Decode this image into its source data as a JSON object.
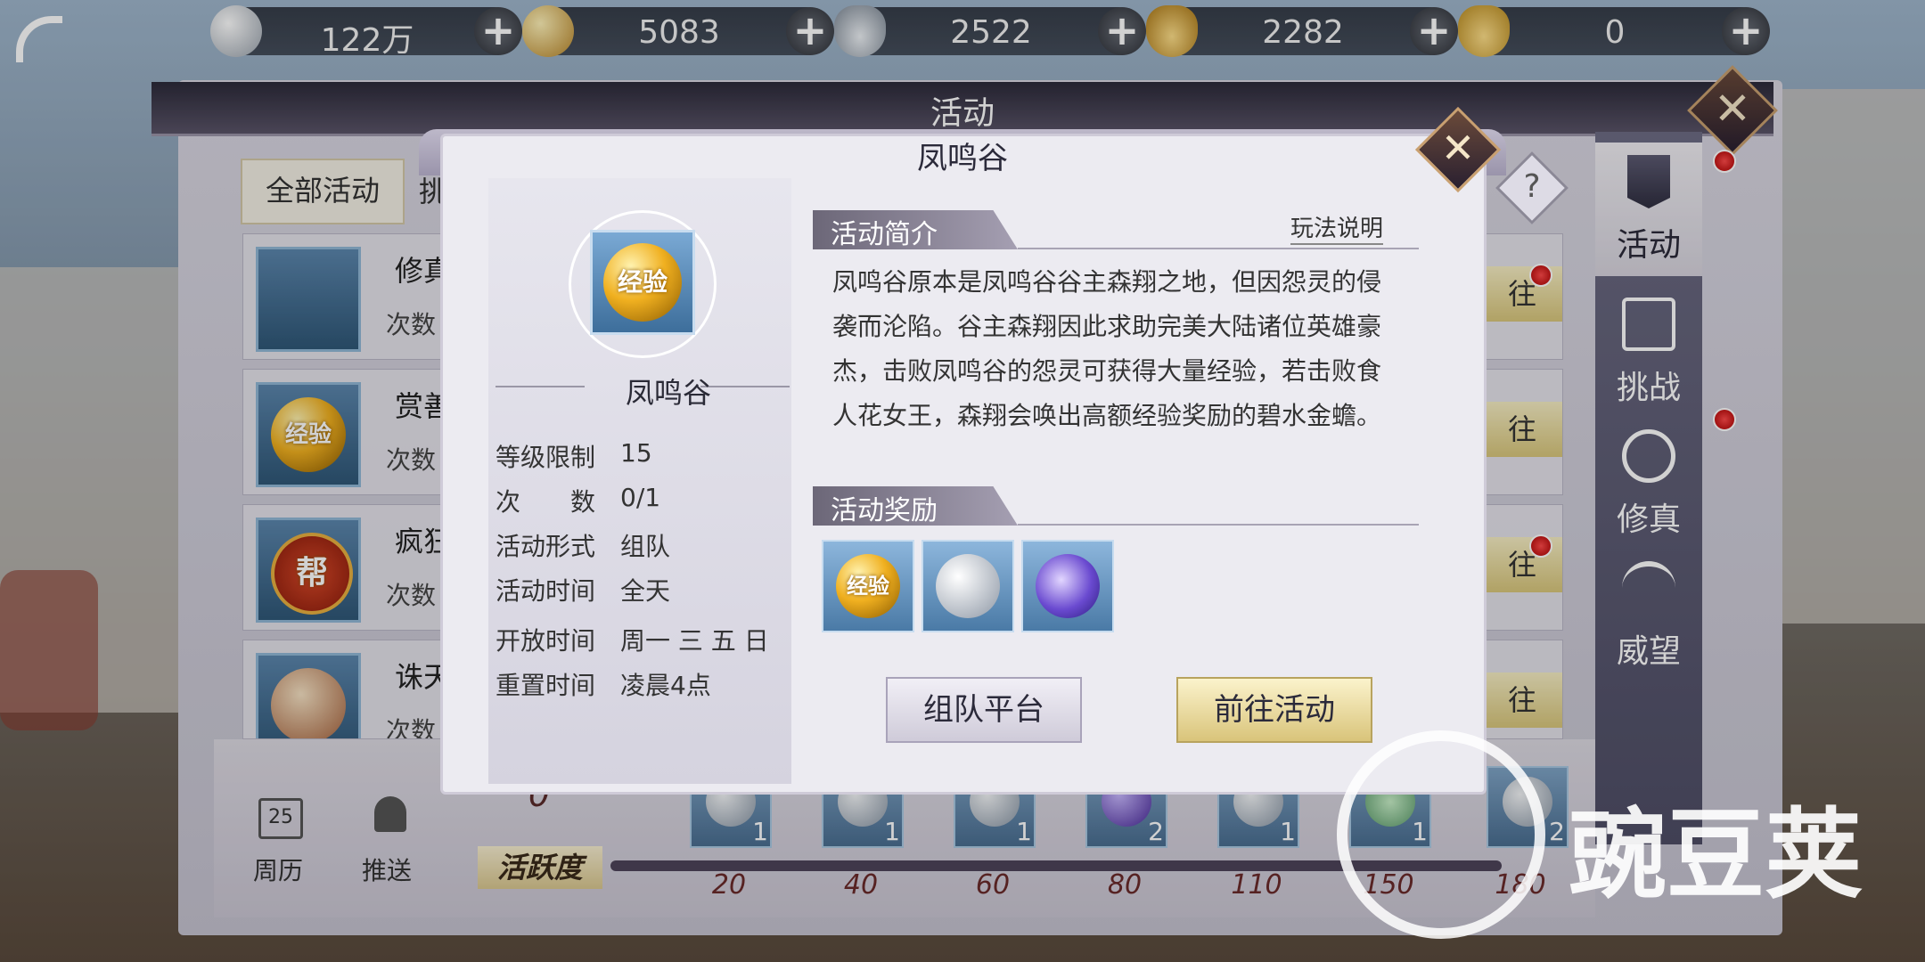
{
  "currency": [
    {
      "icon": "silver-coin-icon",
      "value": "122万"
    },
    {
      "icon": "gold-coin-icon",
      "value": "5083"
    },
    {
      "icon": "silver-ingot-icon",
      "value": "2522"
    },
    {
      "icon": "locked-gold-ingot-icon",
      "value": "2282"
    },
    {
      "icon": "gold-ingot-icon",
      "value": "0"
    }
  ],
  "plus_symbol": "+",
  "main": {
    "title": "活动",
    "tab_all": "全部活动",
    "tab_second": "挑",
    "rows": [
      {
        "name": "修真",
        "count": "次数",
        "btn": "往",
        "icon": "mask-icon"
      },
      {
        "name": "赏善",
        "count": "次数",
        "btn": "往",
        "icon": "exp-orb-icon"
      },
      {
        "name": "疯狂",
        "count": "次数",
        "btn": "往",
        "icon": "guild-badge-icon"
      },
      {
        "name": "诛天",
        "count": "次数",
        "btn": "往",
        "icon": "pagoda-orb-icon"
      }
    ],
    "row_exp_text": "经验",
    "row_guild_text": "帮"
  },
  "sidebar": [
    {
      "label": "活动",
      "icon": "banner-icon"
    },
    {
      "label": "挑战",
      "icon": "challenge-icon"
    },
    {
      "label": "修真",
      "icon": "spiral-icon"
    },
    {
      "label": "威望",
      "icon": "wings-icon"
    }
  ],
  "bottom": {
    "calendar": "周历",
    "calendar_day": "25",
    "push": "推送",
    "activity_value": "0",
    "activity_label": "活跃度",
    "milestones": [
      {
        "mark": "20",
        "count": "1"
      },
      {
        "mark": "40",
        "count": "1"
      },
      {
        "mark": "60",
        "count": "1"
      },
      {
        "mark": "80",
        "count": "2"
      },
      {
        "mark": "110",
        "count": "1"
      },
      {
        "mark": "150",
        "count": "1"
      },
      {
        "mark": "180",
        "count": "2"
      }
    ]
  },
  "popup": {
    "title": "凤鸣谷",
    "close": "✕",
    "help": "?",
    "icon_text": "经验",
    "name": "凤鸣谷",
    "info": [
      {
        "k": "等级限制",
        "v": "15"
      },
      {
        "k": "次　　数",
        "v": "0/1"
      },
      {
        "k": "活动形式",
        "v": "组队"
      },
      {
        "k": "活动时间",
        "v": "全天"
      },
      {
        "k": "开放时间",
        "v": "周一 三 五 日"
      },
      {
        "k": "重置时间",
        "v": "凌晨4点"
      }
    ],
    "intro_title": "活动简介",
    "rules": "玩法说明",
    "description": "凤鸣谷原本是凤鸣谷谷主森翔之地，但因怨灵的侵袭而沦陷。谷主森翔因此求助完美大陆诸位英雄豪杰，击败凤鸣谷的怨灵可获得大量经验，若击败食人花女王，森翔会唤出高额经验奖励的碧水金蟾。",
    "reward_title": "活动奖励",
    "rewards": [
      {
        "icon": "exp-orb-icon",
        "text": "经验"
      },
      {
        "icon": "silver-dragon-coin-icon"
      },
      {
        "icon": "purple-spirit-orb-icon"
      }
    ],
    "btn_team": "组队平台",
    "btn_go": "前往活动"
  },
  "watermark": "豌豆荚",
  "colors": {
    "gold": "#d9c47a",
    "panel": "#ecebf1",
    "sidebar": "#5e5d76",
    "badge_red": "#d01010"
  }
}
